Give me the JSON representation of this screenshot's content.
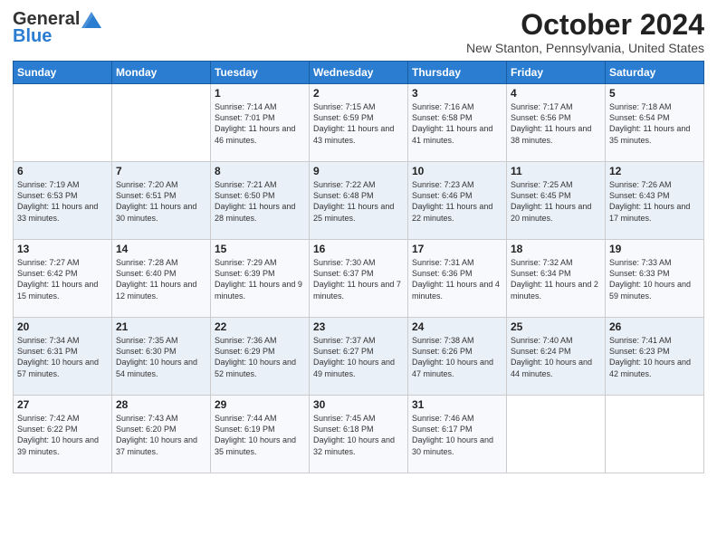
{
  "header": {
    "logo_general": "General",
    "logo_blue": "Blue",
    "month_title": "October 2024",
    "location": "New Stanton, Pennsylvania, United States"
  },
  "days_of_week": [
    "Sunday",
    "Monday",
    "Tuesday",
    "Wednesday",
    "Thursday",
    "Friday",
    "Saturday"
  ],
  "weeks": [
    [
      {
        "day": "",
        "info": ""
      },
      {
        "day": "",
        "info": ""
      },
      {
        "day": "1",
        "info": "Sunrise: 7:14 AM\nSunset: 7:01 PM\nDaylight: 11 hours and 46 minutes."
      },
      {
        "day": "2",
        "info": "Sunrise: 7:15 AM\nSunset: 6:59 PM\nDaylight: 11 hours and 43 minutes."
      },
      {
        "day": "3",
        "info": "Sunrise: 7:16 AM\nSunset: 6:58 PM\nDaylight: 11 hours and 41 minutes."
      },
      {
        "day": "4",
        "info": "Sunrise: 7:17 AM\nSunset: 6:56 PM\nDaylight: 11 hours and 38 minutes."
      },
      {
        "day": "5",
        "info": "Sunrise: 7:18 AM\nSunset: 6:54 PM\nDaylight: 11 hours and 35 minutes."
      }
    ],
    [
      {
        "day": "6",
        "info": "Sunrise: 7:19 AM\nSunset: 6:53 PM\nDaylight: 11 hours and 33 minutes."
      },
      {
        "day": "7",
        "info": "Sunrise: 7:20 AM\nSunset: 6:51 PM\nDaylight: 11 hours and 30 minutes."
      },
      {
        "day": "8",
        "info": "Sunrise: 7:21 AM\nSunset: 6:50 PM\nDaylight: 11 hours and 28 minutes."
      },
      {
        "day": "9",
        "info": "Sunrise: 7:22 AM\nSunset: 6:48 PM\nDaylight: 11 hours and 25 minutes."
      },
      {
        "day": "10",
        "info": "Sunrise: 7:23 AM\nSunset: 6:46 PM\nDaylight: 11 hours and 22 minutes."
      },
      {
        "day": "11",
        "info": "Sunrise: 7:25 AM\nSunset: 6:45 PM\nDaylight: 11 hours and 20 minutes."
      },
      {
        "day": "12",
        "info": "Sunrise: 7:26 AM\nSunset: 6:43 PM\nDaylight: 11 hours and 17 minutes."
      }
    ],
    [
      {
        "day": "13",
        "info": "Sunrise: 7:27 AM\nSunset: 6:42 PM\nDaylight: 11 hours and 15 minutes."
      },
      {
        "day": "14",
        "info": "Sunrise: 7:28 AM\nSunset: 6:40 PM\nDaylight: 11 hours and 12 minutes."
      },
      {
        "day": "15",
        "info": "Sunrise: 7:29 AM\nSunset: 6:39 PM\nDaylight: 11 hours and 9 minutes."
      },
      {
        "day": "16",
        "info": "Sunrise: 7:30 AM\nSunset: 6:37 PM\nDaylight: 11 hours and 7 minutes."
      },
      {
        "day": "17",
        "info": "Sunrise: 7:31 AM\nSunset: 6:36 PM\nDaylight: 11 hours and 4 minutes."
      },
      {
        "day": "18",
        "info": "Sunrise: 7:32 AM\nSunset: 6:34 PM\nDaylight: 11 hours and 2 minutes."
      },
      {
        "day": "19",
        "info": "Sunrise: 7:33 AM\nSunset: 6:33 PM\nDaylight: 10 hours and 59 minutes."
      }
    ],
    [
      {
        "day": "20",
        "info": "Sunrise: 7:34 AM\nSunset: 6:31 PM\nDaylight: 10 hours and 57 minutes."
      },
      {
        "day": "21",
        "info": "Sunrise: 7:35 AM\nSunset: 6:30 PM\nDaylight: 10 hours and 54 minutes."
      },
      {
        "day": "22",
        "info": "Sunrise: 7:36 AM\nSunset: 6:29 PM\nDaylight: 10 hours and 52 minutes."
      },
      {
        "day": "23",
        "info": "Sunrise: 7:37 AM\nSunset: 6:27 PM\nDaylight: 10 hours and 49 minutes."
      },
      {
        "day": "24",
        "info": "Sunrise: 7:38 AM\nSunset: 6:26 PM\nDaylight: 10 hours and 47 minutes."
      },
      {
        "day": "25",
        "info": "Sunrise: 7:40 AM\nSunset: 6:24 PM\nDaylight: 10 hours and 44 minutes."
      },
      {
        "day": "26",
        "info": "Sunrise: 7:41 AM\nSunset: 6:23 PM\nDaylight: 10 hours and 42 minutes."
      }
    ],
    [
      {
        "day": "27",
        "info": "Sunrise: 7:42 AM\nSunset: 6:22 PM\nDaylight: 10 hours and 39 minutes."
      },
      {
        "day": "28",
        "info": "Sunrise: 7:43 AM\nSunset: 6:20 PM\nDaylight: 10 hours and 37 minutes."
      },
      {
        "day": "29",
        "info": "Sunrise: 7:44 AM\nSunset: 6:19 PM\nDaylight: 10 hours and 35 minutes."
      },
      {
        "day": "30",
        "info": "Sunrise: 7:45 AM\nSunset: 6:18 PM\nDaylight: 10 hours and 32 minutes."
      },
      {
        "day": "31",
        "info": "Sunrise: 7:46 AM\nSunset: 6:17 PM\nDaylight: 10 hours and 30 minutes."
      },
      {
        "day": "",
        "info": ""
      },
      {
        "day": "",
        "info": ""
      }
    ]
  ]
}
